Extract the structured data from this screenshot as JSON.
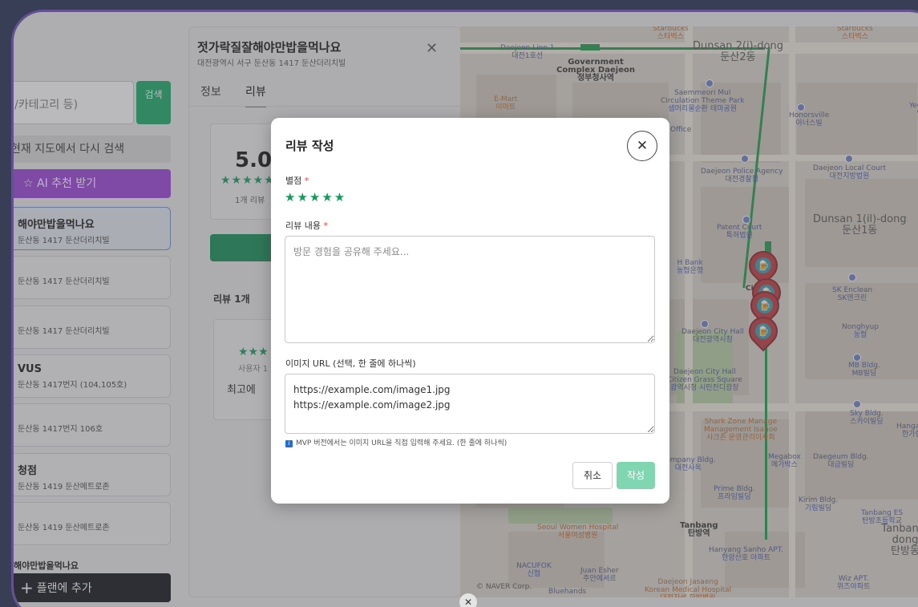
{
  "left_panel": {
    "search_placeholder": "/카테고리 등)",
    "search_button": "검색",
    "research_button": "현재 지도에서 다시 검색",
    "ai_button": "AI 추천 받기",
    "results": [
      {
        "title": "해야만밥을먹나요",
        "addr": "둔산동 1417 둔산더리치빌"
      },
      {
        "title": "",
        "addr": "둔산동 1417 둔산더리치빌"
      },
      {
        "title": "",
        "addr": "둔산동 1417 둔산더리치빌"
      },
      {
        "title": "VUS",
        "addr": "둔산동 1417번지 (104,105호)"
      },
      {
        "title": "",
        "addr": "둔산동 1417번지 106호"
      },
      {
        "title": "청점",
        "addr": "둔산동 1419 둔산메트로존"
      },
      {
        "title": "",
        "addr": "둔산동 1419 둔산메트로존"
      }
    ],
    "planned_label": "해야만밥을먹나요",
    "add_plan_button": "플랜에 추가"
  },
  "detail": {
    "title": "젓가락질잘해야만밥을먹나요",
    "address": "대전광역시 서구 둔산동 1417 둔산더리치빌",
    "tabs": [
      "정보",
      "리뷰"
    ],
    "active_tab": "리뷰",
    "rating": "5.0",
    "stars": "★★★★★",
    "rating_count": "1개 리뷰",
    "review_count_label": "리뷰 1개",
    "review": {
      "stars": "★★★",
      "user": "사용자 1",
      "text": "최고에"
    }
  },
  "map": {
    "labels": {
      "starbucks1": "Starbucks\n스타벅스",
      "starbucks2": "Starbucks\n스타벅스",
      "daejeon_line": "Daejeon Line 1\n대전1호선",
      "gov_complex": "Government\nComplex Daejeon\n정부청사역",
      "dunsan2": "Dunsan 2(i)-dong\n둔산2동",
      "saemmeori": "Saemmeori Mul\nCirculation Theme Park\n샘머리물순환 테마공원",
      "emart": "E-Mart\n이마트",
      "honorsville": "Honorsville\n아너스빌",
      "yeongmin": "Yeongm\n영민",
      "police": "Daejeon Police Agency\n대전경찰청",
      "court": "Daejeon Local Court\n대전지방법원",
      "office": "Office",
      "patent": "Patent Court\n특허법원",
      "dunsan1": "Dunsan 1(il)-dong\n둔산1동",
      "hbank": "H Bank\n농협은행",
      "city": "City",
      "sk": "SK Enclean\nSK엔크린",
      "city_hall": "Daejeon City Hall\n대전광역시청",
      "nonghyup": "Nonghyup\n농협",
      "mb": "MB Bldg.\nMB빌딩",
      "grass": "Daejeon City Hall\nCitizen Grass Square\n광역시청 시민잔디광장",
      "sky": "Sky Bldg.\n스카이빌딩",
      "hangaram": "Hangaram\n한가람아",
      "sharkzone": "Shark Zone Manage\nManagement Isahoe\n샤크존 운영관리이사회",
      "company": "Company Bldg.\n대전사옥",
      "megabox": "Megabox\n메가박스",
      "daegeum": "Daegeum Bldg.\n대금빌딩",
      "prime": "Prime Bldg.\n프라임빌딩",
      "kirim": "Kirim Bldg.\n기림빌딩",
      "tanbang_es": "Tanbang ES\n탄방초등학교",
      "tanbang_dong": "Tanbang-dong\n탄방동",
      "women_hospital": "Seoul Women Hospital\n서울여성병원",
      "tanbang": "Tanbang\n탄방역",
      "hanyang": "Hanyang Sanho APT.\n한양산호 아파트",
      "nacufok": "NACUFOK\n신협",
      "juanesher": "Juan Esher\n주안에셔르",
      "jasaeng": "Daejeon Jasaeng\nKorean Medical Hospital\n대전자생 한방병원",
      "wiz": "Wiz APT.\n위즈아파트",
      "bluehands": "Bluehands",
      "naver": "© NAVER Corp."
    },
    "pin_colors": {
      "pin": "#c0353a",
      "inner": "#2f9fb0"
    }
  },
  "modal": {
    "title": "리뷰 작성",
    "rating_label": "별점",
    "stars": "★★★★★",
    "content_label": "리뷰 내용",
    "content_placeholder": "방문 경험을 공유해 주세요...",
    "image_label": "이미지 URL (선택, 한 줄에 하나씩)",
    "image_value": "https://example.com/image1.jpg\nhttps://example.com/image2.jpg",
    "hint": "MVP 버전에서는 이미지 URL을 직접 입력해 주세요. (한 줄에 하나씩)",
    "cancel": "취소",
    "submit": "작성",
    "required_mark": "*"
  },
  "icons": {
    "close": "close-icon",
    "star": "star-icon",
    "plus": "plus-icon",
    "info": "info-icon",
    "beer": "beer-icon"
  },
  "colors": {
    "accent": "#17a968",
    "purple": "#9a3ed8",
    "submit": "#7fd6b0"
  }
}
